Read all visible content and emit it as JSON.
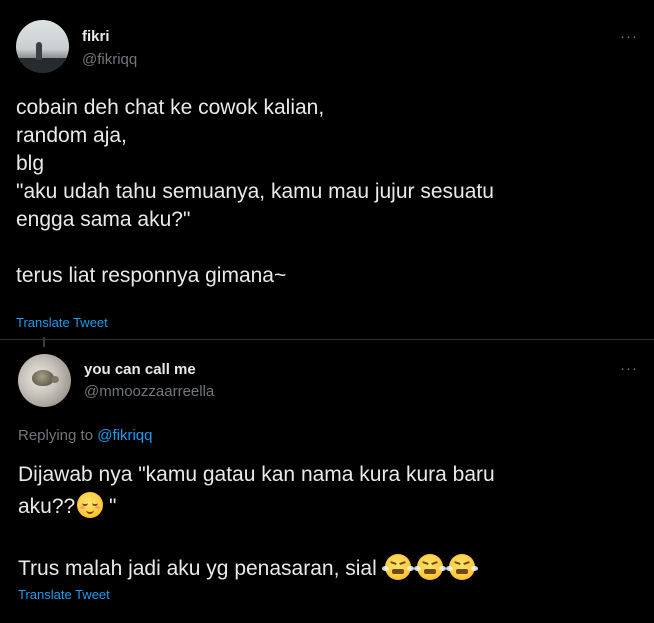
{
  "tweet": {
    "author_name": "fikri",
    "author_handle": "@fikriqq",
    "more_label": "···",
    "lines": [
      "cobain deh chat ke cowok kalian,",
      "random aja,",
      "blg",
      "\"aku udah tahu semuanya, kamu mau jujur sesuatu",
      "engga sama aku?\"",
      "",
      "terus liat responnya gimana~"
    ],
    "translate_label": "Translate Tweet"
  },
  "reply": {
    "author_name": "you can call me",
    "author_handle": "@mmoozzaarreella",
    "more_label": "···",
    "replying_prefix": "Replying to ",
    "replying_mention": "@fikriqq",
    "line1": "Dijawab nya \"kamu gatau kan nama kura kura baru",
    "line2_text": "aku??",
    "line2_suffix": " \"",
    "line3": "Trus malah jadi aku yg penasaran, sial",
    "translate_label": "Translate Tweet",
    "emojis": [
      "relieved-face-icon",
      "steam-from-nose-face-icon"
    ]
  },
  "colors": {
    "background": "#000000",
    "text": "#e7e9ea",
    "secondary": "#71767b",
    "link": "#1d9bf0",
    "divider": "#2f3336"
  }
}
